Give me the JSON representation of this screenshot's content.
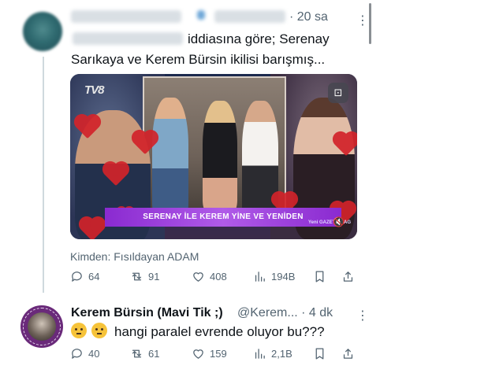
{
  "tweet1": {
    "time": "· 20 sa",
    "more": "⋮",
    "text_line1": "iddiasına göre; Serenay",
    "text_line2": "Sarıkaya ve Kerem Bürsin ikilisi barışmış...",
    "media": {
      "channel_logo": "TV8",
      "banner": "SERENAY İLE KEREM YİNE VE YENİDEN",
      "watermark": "Yeni GAZETE MAG",
      "mute_icon": "🔇",
      "media_icon": "⊡"
    },
    "source": "Kimden: Fısıldayan ADAM",
    "actions": {
      "replies": "64",
      "retweets": "91",
      "likes": "408",
      "views": "194B"
    }
  },
  "tweet2": {
    "name": "Kerem Bürsin (Mavi Tik ;)",
    "handle": "@Kerem...",
    "time": "· 4 dk",
    "more": "⋮",
    "text": "hangi paralel evrende oluyor bu???",
    "actions": {
      "replies": "40",
      "retweets": "61",
      "likes": "159",
      "views": "2,1B"
    }
  },
  "colors": {
    "text": "#0f1419",
    "muted": "#536471",
    "banner": "#8a2ad0",
    "heart": "#d2232a"
  }
}
